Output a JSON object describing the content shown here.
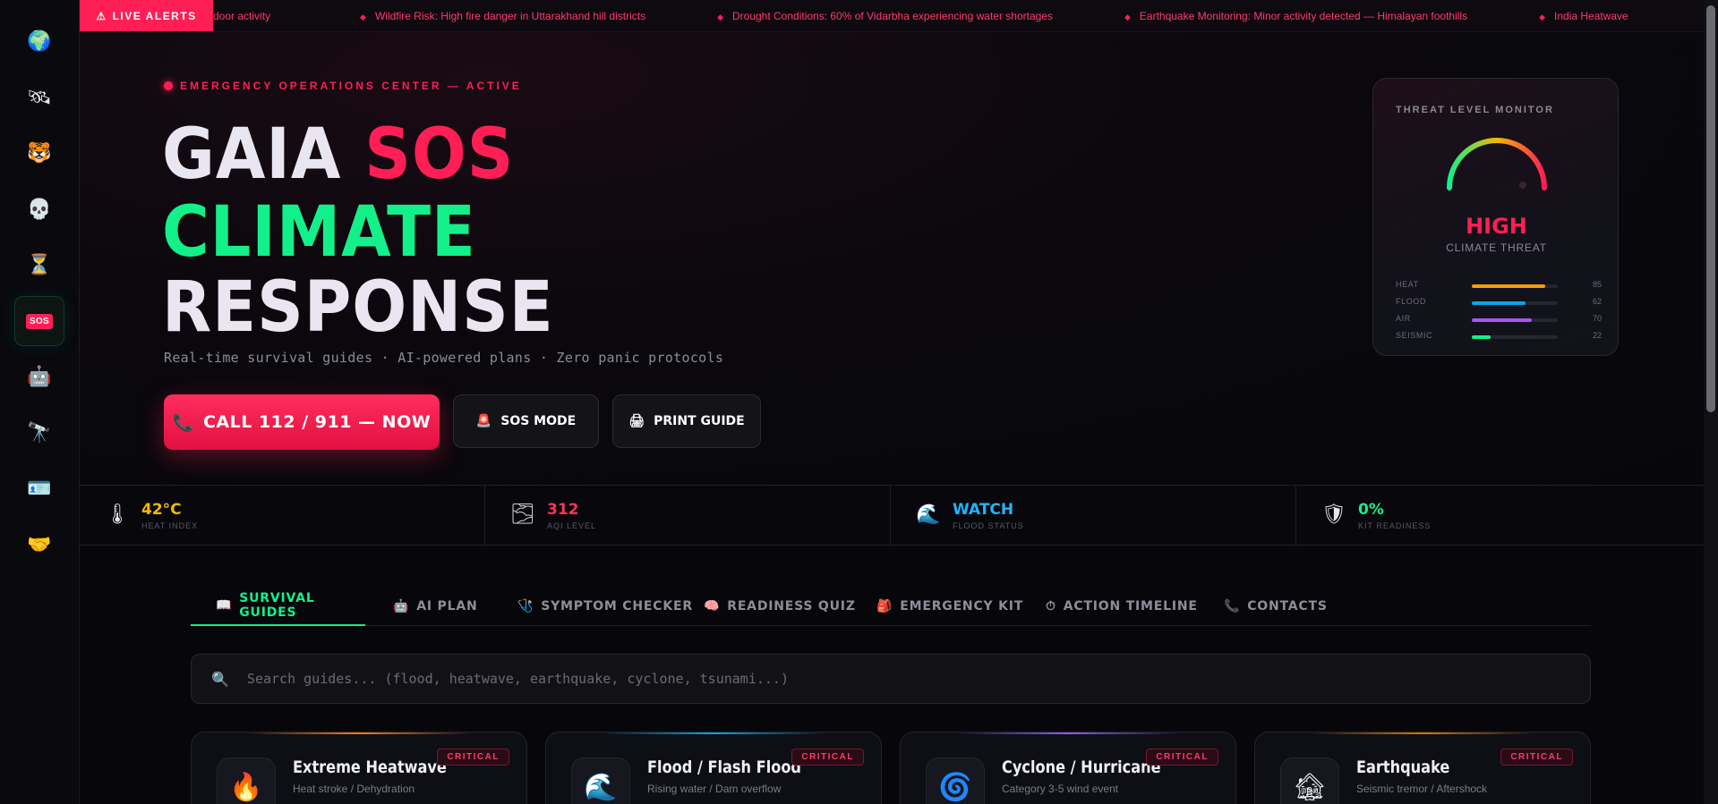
{
  "sidebar": {
    "items": [
      {
        "name": "globe",
        "glyph": "🌍"
      },
      {
        "name": "satellite",
        "glyph": "🛰"
      },
      {
        "name": "tiger",
        "glyph": "🐯"
      },
      {
        "name": "skull",
        "glyph": "💀"
      },
      {
        "name": "hourglass",
        "glyph": "⏳"
      },
      {
        "name": "sos",
        "glyph": "SOS"
      },
      {
        "name": "robot",
        "glyph": "🤖"
      },
      {
        "name": "telescope",
        "glyph": "🔭"
      },
      {
        "name": "id-card",
        "glyph": "🪪"
      },
      {
        "name": "handshake",
        "glyph": "🤝"
      }
    ]
  },
  "ticker": {
    "label": "LIVE ALERTS",
    "label_icon": "⚠",
    "items": [
      "door activity",
      "Wildfire Risk: High fire danger in Uttarakhand hill districts",
      "Drought Conditions: 60% of Vidarbha experiencing water shortages",
      "Earthquake Monitoring: Minor activity detected — Himalayan foothills",
      "India Heatwave"
    ]
  },
  "hero": {
    "status": "EMERGENCY OPERATIONS CENTER — ACTIVE",
    "title_white_1": "GAIA",
    "title_red": "SOS",
    "title_green": "CLIMATE",
    "title_white_2": "RESPONSE",
    "tagline": "Real-time survival guides · AI-powered plans · Zero panic protocols",
    "buttons": {
      "call": {
        "label": "CALL 112 / 911 — NOW",
        "icon": "📞"
      },
      "sos": {
        "label": "SOS MODE",
        "icon": "🚨"
      },
      "print": {
        "label": "PRINT GUIDE",
        "icon": "🖨"
      }
    }
  },
  "threat": {
    "title": "THREAT LEVEL MONITOR",
    "level": "HIGH",
    "subtitle": "CLIMATE THREAT",
    "meters": [
      {
        "label": "HEAT",
        "value": 85,
        "color": "#f59e0b"
      },
      {
        "label": "FLOOD",
        "value": 62,
        "color": "#0ea5e9"
      },
      {
        "label": "AIR",
        "value": 70,
        "color": "#a855f7"
      },
      {
        "label": "SEISMIC",
        "value": 22,
        "color": "#13f08a"
      }
    ]
  },
  "stats": [
    {
      "icon": "🌡",
      "value": "42°C",
      "label": "HEAT INDEX",
      "color": "#f5b800"
    },
    {
      "icon": "🌫",
      "value": "312",
      "label": "AQI LEVEL",
      "color": "#ff3355"
    },
    {
      "icon": "🌊",
      "value": "WATCH",
      "label": "FLOOD STATUS",
      "color": "#20b4ff"
    },
    {
      "icon": "🛡",
      "value": "0%",
      "label": "KIT READINESS",
      "color": "#13f08a"
    }
  ],
  "tabs": [
    {
      "icon": "📖",
      "label": "SURVIVAL GUIDES",
      "active": true
    },
    {
      "icon": "🤖",
      "label": "AI PLAN",
      "active": false
    },
    {
      "icon": "🩺",
      "label": "SYMPTOM CHECKER",
      "active": false
    },
    {
      "icon": "🧠",
      "label": "READINESS QUIZ",
      "active": false
    },
    {
      "icon": "🎒",
      "label": "EMERGENCY KIT",
      "active": false
    },
    {
      "icon": "⏱",
      "label": "ACTION TIMELINE",
      "active": false
    },
    {
      "icon": "📞",
      "label": "CONTACTS",
      "active": false
    }
  ],
  "search": {
    "icon": "🔍",
    "placeholder": "Search guides... (flood, heatwave, earthquake, cyclone, tsunami...)"
  },
  "cards": [
    {
      "icon": "🔥",
      "name": "Extreme Heatwave",
      "sub": "Heat stroke / Dehydration",
      "badge": "CRITICAL",
      "accent": "#ff7a1a"
    },
    {
      "icon": "🌊",
      "name": "Flood / Flash Flood",
      "sub": "Rising water / Dam overflow",
      "badge": "CRITICAL",
      "accent": "#0ea5e9"
    },
    {
      "icon": "🌀",
      "name": "Cyclone / Hurricane",
      "sub": "Category 3-5 wind event",
      "badge": "CRITICAL",
      "accent": "#8b5cf6"
    },
    {
      "icon": "🏚",
      "name": "Earthquake",
      "sub": "Seismic tremor / Aftershock",
      "badge": "CRITICAL",
      "accent": "#d97706"
    }
  ]
}
